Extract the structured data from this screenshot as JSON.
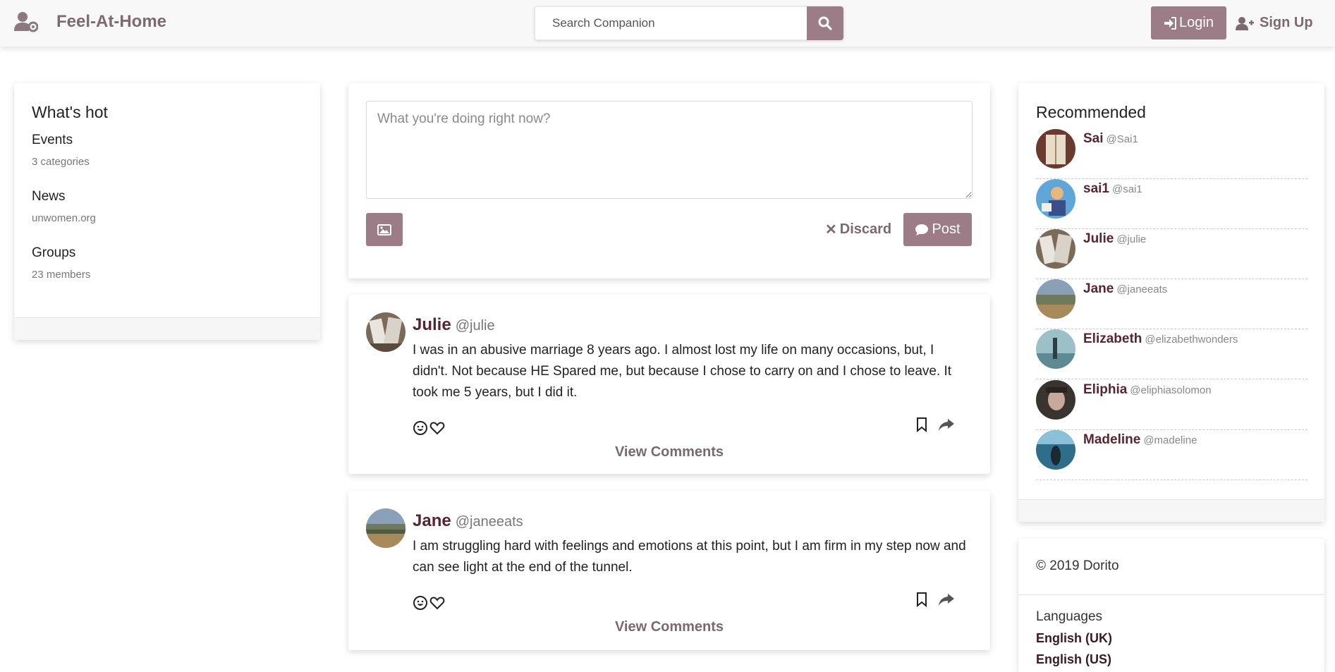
{
  "header": {
    "brand": "Feel-At-Home",
    "search_placeholder": "Search Companion",
    "login_label": "Login",
    "signup_label": "Sign Up"
  },
  "whats_hot": {
    "title": "What's hot",
    "items": [
      {
        "title": "Events",
        "sub": "3 categories"
      },
      {
        "title": "News",
        "sub": "unwomen.org"
      },
      {
        "title": "Groups",
        "sub": "23 members"
      }
    ]
  },
  "composer": {
    "placeholder": "What you're doing right now?",
    "discard_label": "Discard",
    "post_label": "Post"
  },
  "posts": [
    {
      "name": "Julie",
      "handle": "@julie",
      "text": "I was in an abusive marriage 8 years ago. I almost lost my life on many occasions, but, I didn't. Not because HE Spared me, but because I chose to carry on and I chose to leave. It took me 5 years, but I did it.",
      "comments_label": "View Comments"
    },
    {
      "name": "Jane",
      "handle": "@janeeats",
      "text": "I am struggling hard with feelings and emotions at this point, but I am firm in my step now and can see light at the end of the tunnel.",
      "comments_label": "View Comments"
    }
  ],
  "recommended": {
    "title": "Recommended",
    "users": [
      {
        "name": "Sai",
        "handle": "@Sai1"
      },
      {
        "name": "sai1",
        "handle": "@sai1"
      },
      {
        "name": "Julie",
        "handle": "@julie"
      },
      {
        "name": "Jane",
        "handle": "@janeeats"
      },
      {
        "name": "Elizabeth",
        "handle": "@elizabethwonders"
      },
      {
        "name": "Eliphia",
        "handle": "@eliphiasolomon"
      },
      {
        "name": "Madeline",
        "handle": "@madeline"
      }
    ]
  },
  "footer": {
    "copyright": "© 2019 Dorito",
    "languages_label": "Languages",
    "languages": [
      "English (UK)",
      "English (US)"
    ]
  },
  "colors": {
    "accent": "#9c7c86",
    "name": "#5a2330",
    "brand": "#7d6a70"
  },
  "icons": [
    "user-cog-icon",
    "search-icon",
    "sign-in-icon",
    "user-plus-icon",
    "image-icon",
    "times-icon",
    "comment-icon",
    "smile-icon",
    "heart-icon",
    "bookmark-icon",
    "share-icon"
  ]
}
